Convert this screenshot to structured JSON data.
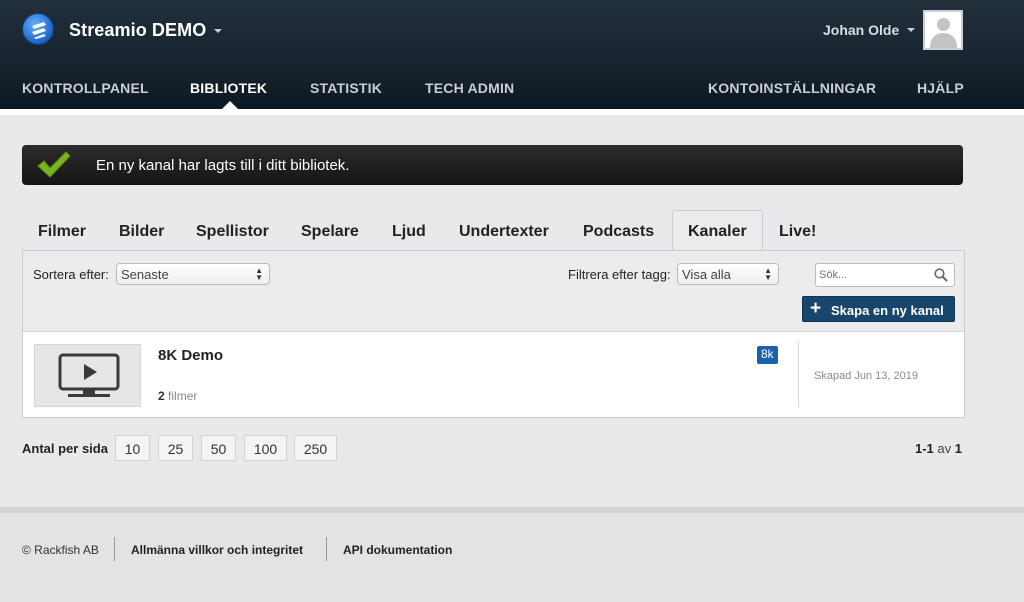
{
  "header": {
    "brand": "Streamio DEMO",
    "user_name": "Johan Olde",
    "nav": [
      {
        "label": "KONTROLLPANEL"
      },
      {
        "label": "BIBLIOTEK"
      },
      {
        "label": "STATISTIK"
      },
      {
        "label": "TECH ADMIN"
      },
      {
        "label": "KONTOINSTÄLLNINGAR"
      },
      {
        "label": "HJÄLP"
      }
    ],
    "active_nav": "BIBLIOTEK"
  },
  "alert": {
    "message": "En ny kanal har lagts till i ditt bibliotek."
  },
  "tabs": [
    {
      "label": "Filmer"
    },
    {
      "label": "Bilder"
    },
    {
      "label": "Spellistor"
    },
    {
      "label": "Spelare"
    },
    {
      "label": "Ljud"
    },
    {
      "label": "Undertexter"
    },
    {
      "label": "Podcasts"
    },
    {
      "label": "Kanaler"
    },
    {
      "label": "Live!"
    }
  ],
  "active_tab": "Kanaler",
  "toolbar": {
    "sort_label": "Sortera efter:",
    "sort_value": "Senaste",
    "filter_label": "Filtrera efter tagg:",
    "filter_value": "Visa alla",
    "search_placeholder": "Sök...",
    "create_button": "Skapa en ny kanal"
  },
  "channels": [
    {
      "title": "8K Demo",
      "film_count": "2",
      "film_unit": "filmer",
      "tag": "8k",
      "created": "Skapad Jun 13, 2019"
    }
  ],
  "pagination": {
    "per_page_label": "Antal per sida",
    "options": [
      "10",
      "25",
      "50",
      "100",
      "250"
    ],
    "range": "1-1",
    "of_label": "av",
    "total": "1"
  },
  "footer": {
    "copyright": "© Rackfish AB",
    "terms": "Allmänna villkor och integritet",
    "api": "API dokumentation"
  },
  "colors": {
    "header_dark": "#0d1922",
    "accent_button": "#17456c",
    "tag_blue": "#1a62b0",
    "check_green": "#7ab51d"
  }
}
